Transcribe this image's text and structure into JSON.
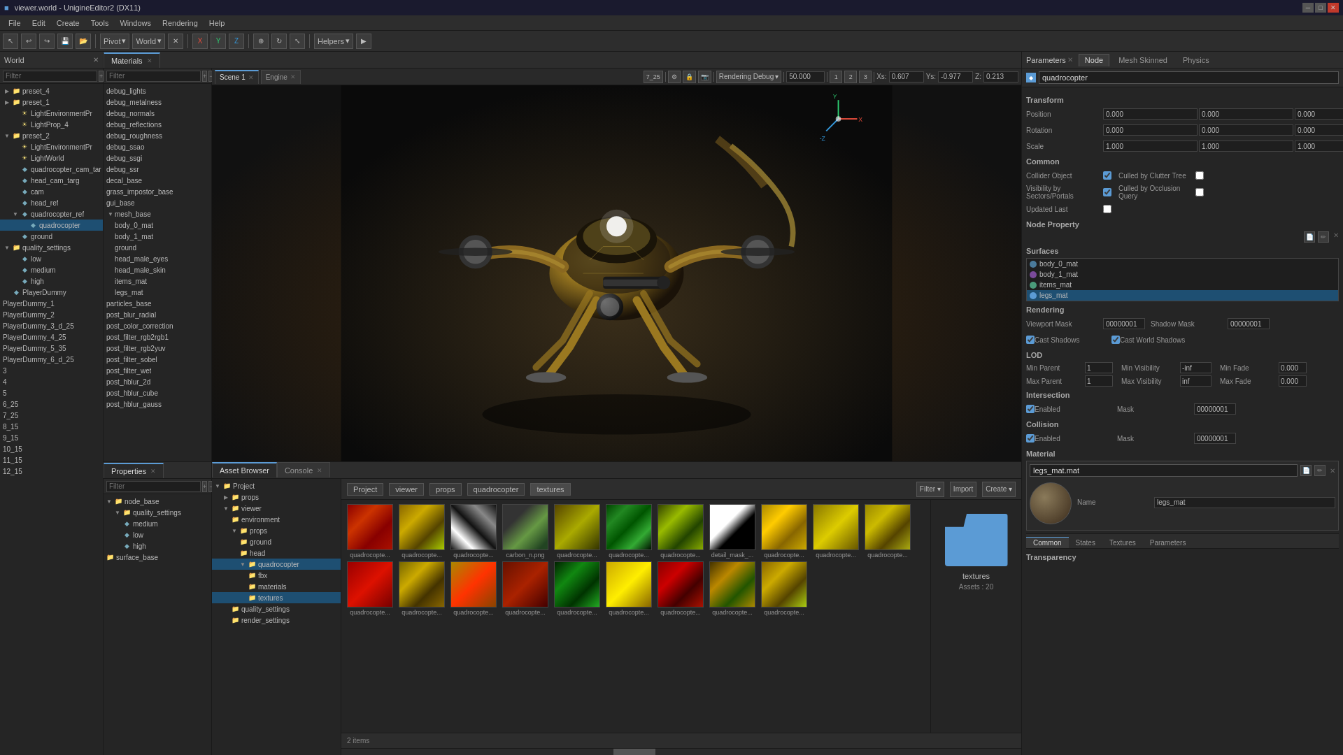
{
  "titlebar": {
    "title": "viewer.world - UnigineEditor2 (DX11)",
    "minimize": "─",
    "maximize": "□",
    "close": "✕"
  },
  "menubar": {
    "items": [
      "File",
      "Edit",
      "Create",
      "Tools",
      "Windows",
      "Rendering",
      "Help"
    ]
  },
  "toolbar": {
    "pivot": "Pivot",
    "world": "World",
    "helpers": "Helpers"
  },
  "world_panel": {
    "title": "World",
    "filter_placeholder": "Filter",
    "tree": [
      {
        "label": "preset_4",
        "level": 0,
        "type": "folder",
        "expanded": true
      },
      {
        "label": "preset_1",
        "level": 0,
        "type": "folder",
        "expanded": true
      },
      {
        "label": "LightEnvironmentPr",
        "level": 1,
        "type": "light"
      },
      {
        "label": "LightProp_4",
        "level": 1,
        "type": "light"
      },
      {
        "label": "preset_2",
        "level": 0,
        "type": "folder",
        "expanded": true
      },
      {
        "label": "LightEnvironmentPr",
        "level": 1,
        "type": "light"
      },
      {
        "label": "LightWorld",
        "level": 1,
        "type": "light"
      },
      {
        "label": "quadrocopter_cam_tar",
        "level": 1,
        "type": "node"
      },
      {
        "label": "head_cam_targ",
        "level": 1,
        "type": "node"
      },
      {
        "label": "cam",
        "level": 1,
        "type": "node"
      },
      {
        "label": "head_ref",
        "level": 1,
        "type": "node"
      },
      {
        "label": "quadrocopter_ref",
        "level": 1,
        "type": "node"
      },
      {
        "label": "quadrocopter",
        "level": 2,
        "type": "node",
        "selected": true
      },
      {
        "label": "ground",
        "level": 1,
        "type": "node"
      },
      {
        "label": "quality_settings",
        "level": 0,
        "type": "folder"
      },
      {
        "label": "low",
        "level": 1,
        "type": "node"
      },
      {
        "label": "medium",
        "level": 1,
        "type": "node"
      },
      {
        "label": "high",
        "level": 1,
        "type": "node"
      },
      {
        "label": "PlayerDummy",
        "level": 0,
        "type": "node"
      },
      {
        "label": "PlayerDummy_1",
        "level": 0,
        "type": "node"
      },
      {
        "label": "PlayerDummy_2",
        "level": 0,
        "type": "node"
      },
      {
        "label": "PlayerDummy_3_d_25",
        "level": 0,
        "type": "node"
      },
      {
        "label": "PlayerDummy_4_25",
        "level": 0,
        "type": "node"
      },
      {
        "label": "PlayerDummy_5_35",
        "level": 0,
        "type": "node"
      },
      {
        "label": "PlayerDummy_6_d_25",
        "level": 0,
        "type": "node"
      },
      {
        "label": "3",
        "level": 0,
        "type": "node"
      },
      {
        "label": "4",
        "level": 0,
        "type": "node"
      },
      {
        "label": "5",
        "level": 0,
        "type": "node"
      },
      {
        "label": "6_25",
        "level": 0,
        "type": "node"
      },
      {
        "label": "7_25",
        "level": 0,
        "type": "node"
      },
      {
        "label": "8_15",
        "level": 0,
        "type": "node"
      },
      {
        "label": "9_15",
        "level": 0,
        "type": "node"
      },
      {
        "label": "10_15",
        "level": 0,
        "type": "node"
      },
      {
        "label": "11_15",
        "level": 0,
        "type": "node"
      },
      {
        "label": "12_15",
        "level": 0,
        "type": "node"
      }
    ]
  },
  "materials_panel": {
    "title": "Materials",
    "filter_placeholder": "Filter",
    "items": [
      "debug_lights",
      "debug_metalness",
      "debug_normals",
      "debug_reflections",
      "debug_roughness",
      "debug_ssao",
      "debug_ssgi",
      "debug_ssr",
      "decal_base",
      "grass_impostor_base",
      "gui_base",
      "mesh_base",
      "body_0_mat",
      "body_1_mat",
      "ground",
      "head_male_eyes",
      "head_male_skin",
      "items_mat",
      "legs_mat",
      "particles_base",
      "post_blur_radial",
      "post_color_correction",
      "post_filter_rgb2rgb1",
      "post_filter_rgb2yuv",
      "post_filter_sobel",
      "post_filter_wet",
      "post_hblur_2d",
      "post_hblur_cube",
      "post_hblur_gauss"
    ]
  },
  "viewport": {
    "scene": "Scene 1",
    "engine_tab": "Engine",
    "scene_id": "7_25",
    "rendering_mode": "Rendering Debug",
    "value_50": "50.000",
    "num1": "1",
    "num2": "2",
    "num3": "3",
    "x_coord": "0.607",
    "y_coord": "-0.977",
    "z_coord": "0.213"
  },
  "properties_panel": {
    "title": "Properties",
    "tree": [
      {
        "label": "node_base",
        "level": 0,
        "type": "folder",
        "expanded": true
      },
      {
        "label": "quality_settings",
        "level": 1,
        "type": "folder",
        "expanded": true
      },
      {
        "label": "medium",
        "level": 2,
        "type": "node"
      },
      {
        "label": "low",
        "level": 2,
        "type": "node"
      },
      {
        "label": "high",
        "level": 2,
        "type": "node"
      },
      {
        "label": "surface_base",
        "level": 0,
        "type": "folder"
      }
    ]
  },
  "asset_browser": {
    "title": "Asset Browser",
    "console_tab": "Console",
    "breadcrumbs": [
      "Project",
      "viewer",
      "props",
      "quadrocopter",
      "textures"
    ],
    "filter_btn": "Filter",
    "import_btn": "Import",
    "create_btn": "Create",
    "items_count": "2 items",
    "assets_count": "Assets : 20",
    "folder_label": "textures",
    "sidebar_tree": [
      {
        "label": "Project",
        "level": 0,
        "type": "folder",
        "expanded": true
      },
      {
        "label": "props",
        "level": 1,
        "type": "folder",
        "expanded": false
      },
      {
        "label": "viewer",
        "level": 1,
        "type": "folder",
        "expanded": true
      },
      {
        "label": "environment",
        "level": 2,
        "type": "folder"
      },
      {
        "label": "props",
        "level": 2,
        "type": "folder",
        "expanded": true
      },
      {
        "label": "ground",
        "level": 3,
        "type": "folder"
      },
      {
        "label": "head",
        "level": 3,
        "type": "folder"
      },
      {
        "label": "quadrocopter",
        "level": 3,
        "type": "folder",
        "selected": true
      },
      {
        "label": "fbx",
        "level": 4,
        "type": "folder"
      },
      {
        "label": "materials",
        "level": 4,
        "type": "folder"
      },
      {
        "label": "textures",
        "level": 4,
        "type": "folder",
        "selected": true
      },
      {
        "label": "quality_settings",
        "level": 2,
        "type": "folder"
      },
      {
        "label": "render_settings",
        "level": 2,
        "type": "folder"
      }
    ],
    "texture_items": [
      {
        "name": "quadrocopte...",
        "type": "red"
      },
      {
        "name": "quadrocopte...",
        "type": "yellow"
      },
      {
        "name": "quadrocopte...",
        "type": "black"
      },
      {
        "name": "carbon_n.png",
        "type": "mixed1"
      },
      {
        "name": "quadrocopte...",
        "type": "yellow-dark"
      },
      {
        "name": "quadrocopte...",
        "type": "green"
      },
      {
        "name": "quadrocopte...",
        "type": "yellow-green"
      },
      {
        "name": "detail_mask_...",
        "type": "white-black"
      },
      {
        "name": "quadrocopte...",
        "type": "yellow2"
      },
      {
        "name": "quadrocopte...",
        "type": "yellow3"
      },
      {
        "name": "quadrocopte...",
        "type": "yellow-mixed"
      },
      {
        "name": "quadrocopte...",
        "type": "red2"
      },
      {
        "name": "quadrocopte...",
        "type": "yellow-dark2"
      },
      {
        "name": "quadrocopte...",
        "type": "yellow-red"
      },
      {
        "name": "quadrocopte...",
        "type": "red-dark"
      },
      {
        "name": "quadrocopte...",
        "type": "green2"
      },
      {
        "name": "quadrocopte...",
        "type": "yellow4"
      },
      {
        "name": "quadrocopte...",
        "type": "red3"
      },
      {
        "name": "quadrocopte...",
        "type": "mixed2"
      },
      {
        "name": "quadrocopte...",
        "type": "yellow5"
      }
    ]
  },
  "parameters": {
    "title": "Parameters",
    "close_btn": "✕",
    "tabs": [
      "Node",
      "Mesh Skinned",
      "Physics"
    ],
    "node_name": "quadrocopter",
    "transform": {
      "label": "Transform",
      "position": [
        "0.000",
        "0.000",
        "0.000"
      ],
      "rotation": [
        "0.000",
        "0.000",
        "0.000"
      ],
      "scale": [
        "1.000",
        "1.000",
        "1.000"
      ]
    },
    "common": {
      "label": "Common",
      "collider_object": true,
      "culled_by_clutter_tree": false,
      "visibility_by_sectors": true,
      "culled_by_occlusion_query": false,
      "updated_last": false
    },
    "node_property": {
      "label": "Node Property"
    },
    "surfaces": {
      "label": "Surfaces",
      "items": [
        {
          "name": "body_0_mat",
          "color": "#4a7a9b",
          "selected": false
        },
        {
          "name": "body_1_mat",
          "color": "#7a4a9b",
          "selected": false
        },
        {
          "name": "items_mat",
          "color": "#4a9b7a",
          "selected": false
        },
        {
          "name": "legs_mat",
          "color": "#5b9bd5",
          "selected": true
        }
      ]
    },
    "rendering": {
      "label": "Rendering",
      "viewport_mask": "00000001",
      "shadow_mask": "00000001",
      "cast_shadows": true,
      "cast_world_shadows": true
    },
    "lod": {
      "label": "LOD",
      "min_parent": "1",
      "min_visibility": "-inf",
      "min_fade": "0.000",
      "max_parent": "1",
      "max_visibility": "inf",
      "max_fade": "0.000"
    },
    "intersection": {
      "label": "Intersection",
      "enabled": true,
      "mask": "00000001"
    },
    "collision": {
      "label": "Collision",
      "enabled": true,
      "mask": "00000001"
    },
    "material": {
      "label": "Material",
      "file": "legs_mat.mat",
      "name": "legs_mat"
    },
    "mat_tabs": [
      "Common",
      "States",
      "Textures",
      "Parameters"
    ]
  }
}
